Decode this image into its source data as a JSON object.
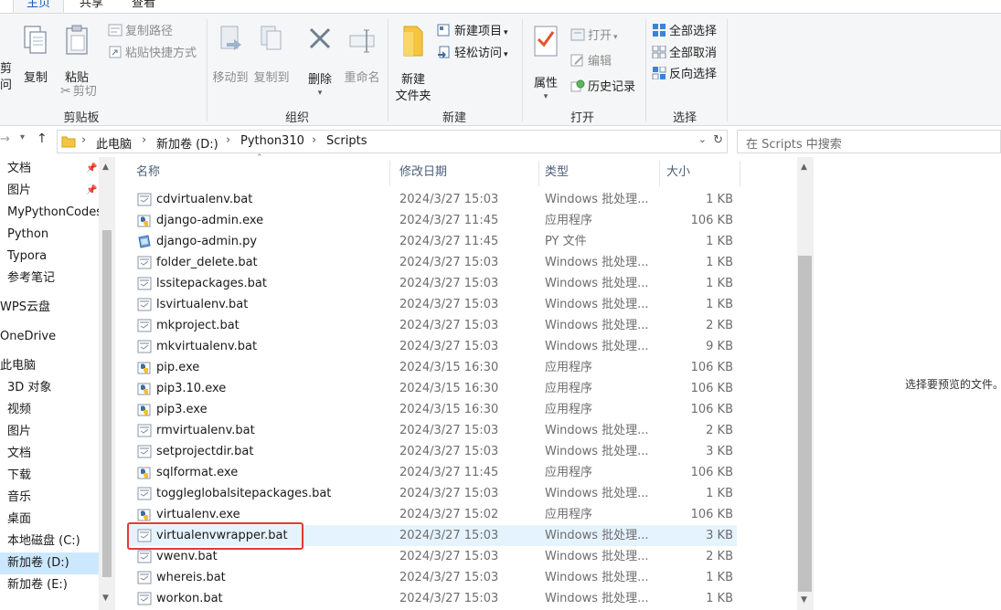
{
  "ribbon_tabs": [
    "主页",
    "共享",
    "查看"
  ],
  "clipboard": {
    "group": "剪贴板",
    "partial_pin": "剪",
    "partial_pin2": "问",
    "copy": "复制",
    "paste": "粘贴",
    "copy_path": "复制路径",
    "paste_shortcut": "粘贴快捷方式",
    "cut": "剪切"
  },
  "organize": {
    "group": "组织",
    "move_to": "移动到",
    "copy_to": "复制到",
    "delete": "删除",
    "rename": "重命名"
  },
  "new": {
    "group": "新建",
    "new_folder_line1": "新建",
    "new_folder_line2": "文件夹",
    "new_item": "新建项目",
    "easy_access": "轻松访问"
  },
  "open": {
    "group": "打开",
    "properties": "属性",
    "open": "打开",
    "edit": "编辑",
    "history": "历史记录"
  },
  "select": {
    "group": "选择",
    "select_all": "全部选择",
    "select_none": "全部取消",
    "invert": "反向选择"
  },
  "address": {
    "crumbs": [
      "此电脑",
      "新加卷 (D:)",
      "Python310",
      "Scripts"
    ],
    "search_placeholder": "在 Scripts 中搜索"
  },
  "nav_items": [
    {
      "label": "文档",
      "pinned": true
    },
    {
      "label": "图片",
      "pinned": true
    },
    {
      "label": "MyPythonCodes",
      "pinned": false
    },
    {
      "label": "Python",
      "pinned": false
    },
    {
      "label": "Typora",
      "pinned": false
    },
    {
      "label": "参考笔记",
      "pinned": false
    },
    {
      "label": "WPS云盘",
      "pinned": false
    },
    {
      "label": "OneDrive",
      "pinned": false
    },
    {
      "label": "此电脑",
      "pinned": false
    },
    {
      "label": "3D 对象",
      "pinned": false
    },
    {
      "label": "视频",
      "pinned": false
    },
    {
      "label": "图片",
      "pinned": false
    },
    {
      "label": "文档",
      "pinned": false
    },
    {
      "label": "下载",
      "pinned": false
    },
    {
      "label": "音乐",
      "pinned": false
    },
    {
      "label": "桌面",
      "pinned": false
    },
    {
      "label": "本地磁盘 (C:)",
      "pinned": false
    },
    {
      "label": "新加卷 (D:)",
      "pinned": false,
      "selected": true
    },
    {
      "label": "新加卷 (E:)",
      "pinned": false
    }
  ],
  "columns": {
    "name": "名称",
    "date": "修改日期",
    "type": "类型",
    "size": "大小"
  },
  "files": [
    {
      "name": "cdvirtualenv.bat",
      "date": "2024/3/27 15:03",
      "type": "Windows 批处理...",
      "size": "1 KB",
      "icon": "bat"
    },
    {
      "name": "django-admin.exe",
      "date": "2024/3/27 11:45",
      "type": "应用程序",
      "size": "106 KB",
      "icon": "exe"
    },
    {
      "name": "django-admin.py",
      "date": "2024/3/27 11:45",
      "type": "PY 文件",
      "size": "1 KB",
      "icon": "py"
    },
    {
      "name": "folder_delete.bat",
      "date": "2024/3/27 15:03",
      "type": "Windows 批处理...",
      "size": "1 KB",
      "icon": "bat"
    },
    {
      "name": "lssitepackages.bat",
      "date": "2024/3/27 15:03",
      "type": "Windows 批处理...",
      "size": "1 KB",
      "icon": "bat"
    },
    {
      "name": "lsvirtualenv.bat",
      "date": "2024/3/27 15:03",
      "type": "Windows 批处理...",
      "size": "1 KB",
      "icon": "bat"
    },
    {
      "name": "mkproject.bat",
      "date": "2024/3/27 15:03",
      "type": "Windows 批处理...",
      "size": "2 KB",
      "icon": "bat"
    },
    {
      "name": "mkvirtualenv.bat",
      "date": "2024/3/27 15:03",
      "type": "Windows 批处理...",
      "size": "9 KB",
      "icon": "bat"
    },
    {
      "name": "pip.exe",
      "date": "2024/3/15 16:30",
      "type": "应用程序",
      "size": "106 KB",
      "icon": "exe"
    },
    {
      "name": "pip3.10.exe",
      "date": "2024/3/15 16:30",
      "type": "应用程序",
      "size": "106 KB",
      "icon": "exe"
    },
    {
      "name": "pip3.exe",
      "date": "2024/3/15 16:30",
      "type": "应用程序",
      "size": "106 KB",
      "icon": "exe"
    },
    {
      "name": "rmvirtualenv.bat",
      "date": "2024/3/27 15:03",
      "type": "Windows 批处理...",
      "size": "2 KB",
      "icon": "bat"
    },
    {
      "name": "setprojectdir.bat",
      "date": "2024/3/27 15:03",
      "type": "Windows 批处理...",
      "size": "3 KB",
      "icon": "bat"
    },
    {
      "name": "sqlformat.exe",
      "date": "2024/3/27 11:45",
      "type": "应用程序",
      "size": "106 KB",
      "icon": "exe"
    },
    {
      "name": "toggleglobalsitepackages.bat",
      "date": "2024/3/27 15:03",
      "type": "Windows 批处理...",
      "size": "1 KB",
      "icon": "bat"
    },
    {
      "name": "virtualenv.exe",
      "date": "2024/3/27 15:02",
      "type": "应用程序",
      "size": "106 KB",
      "icon": "exe"
    },
    {
      "name": "virtualenvwrapper.bat",
      "date": "2024/3/27 15:03",
      "type": "Windows 批处理...",
      "size": "3 KB",
      "icon": "bat",
      "selected": true
    },
    {
      "name": "vwenv.bat",
      "date": "2024/3/27 15:03",
      "type": "Windows 批处理...",
      "size": "2 KB",
      "icon": "bat"
    },
    {
      "name": "whereis.bat",
      "date": "2024/3/27 15:03",
      "type": "Windows 批处理...",
      "size": "1 KB",
      "icon": "bat"
    },
    {
      "name": "workon.bat",
      "date": "2024/3/27 15:03",
      "type": "Windows 批处理...",
      "size": "1 KB",
      "icon": "bat"
    }
  ],
  "preview_message": "选择要预览的文件。",
  "colors": {
    "accent": "#1a5fb4",
    "selection": "#cce8ff",
    "row_selected": "#e5f3ff",
    "highlight_box": "#e53935"
  }
}
